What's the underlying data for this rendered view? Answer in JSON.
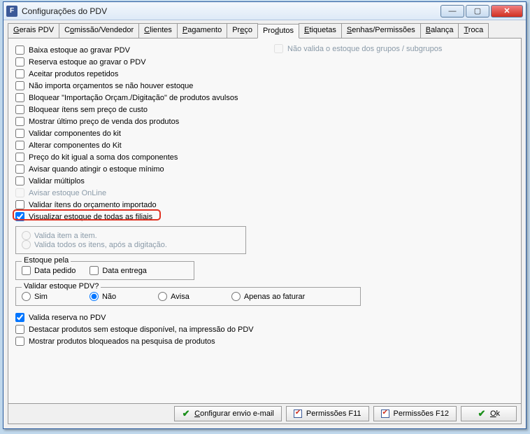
{
  "window": {
    "title": "Configurações do PDV",
    "icon_letter": "F"
  },
  "tabs": [
    {
      "label": "Gerais PDV",
      "accel_index": 0
    },
    {
      "label": "Comissão/Vendedor",
      "accel_index": 1
    },
    {
      "label": "Clientes",
      "accel_index": 0
    },
    {
      "label": "Pagamento",
      "accel_index": 0
    },
    {
      "label": "Preço",
      "accel_index": 2
    },
    {
      "label": "Produtos",
      "accel_index": 3
    },
    {
      "label": "Etiquetas",
      "accel_index": 0
    },
    {
      "label": "Senhas/Permissões",
      "accel_index": 0
    },
    {
      "label": "Balança",
      "accel_index": 0
    },
    {
      "label": "Troca",
      "accel_index": 0
    }
  ],
  "active_tab": 5,
  "checkboxes_left": [
    {
      "label": "Baixa estoque ao gravar PDV",
      "checked": false,
      "disabled": false
    },
    {
      "label": "Reserva estoque ao gravar o PDV",
      "checked": false,
      "disabled": false
    },
    {
      "label": "Aceitar produtos repetidos",
      "checked": false,
      "disabled": false
    },
    {
      "label": "Não importa orçamentos se não houver estoque",
      "checked": false,
      "disabled": false
    },
    {
      "label": "Bloquear \"Importação Orçam./Digitação\" de produtos avulsos",
      "checked": false,
      "disabled": false
    },
    {
      "label": "Bloquear ítens sem preço de custo",
      "checked": false,
      "disabled": false
    },
    {
      "label": "Mostrar último preço de venda dos produtos",
      "checked": false,
      "disabled": false
    },
    {
      "label": "Validar componentes do kit",
      "checked": false,
      "disabled": false
    },
    {
      "label": "Alterar componentes do Kit",
      "checked": false,
      "disabled": false
    },
    {
      "label": "Preço do kit igual a soma dos componentes",
      "checked": false,
      "disabled": false
    },
    {
      "label": "Avisar quando atingir o estoque mínimo",
      "checked": false,
      "disabled": false
    },
    {
      "label": "Validar múltiplos",
      "checked": false,
      "disabled": false
    },
    {
      "label": "Avisar estoque OnLine",
      "checked": false,
      "disabled": true
    },
    {
      "label": "Validar ítens do orçamento importado",
      "checked": false,
      "disabled": false
    },
    {
      "label": "Visualizar estoque de todas as filiais",
      "checked": true,
      "disabled": false,
      "highlight": true
    }
  ],
  "right_checkbox": {
    "label": "Não valida o estoque dos grupos / subgrupos",
    "checked": false,
    "disabled": true
  },
  "valida_group": {
    "options": [
      "Valida item a item.",
      "Valida todos os itens, após a digitação."
    ],
    "disabled": true
  },
  "estoque_pela": {
    "legend": "Estoque pela",
    "options": [
      {
        "label": "Data pedido",
        "checked": false
      },
      {
        "label": "Data entrega",
        "checked": false
      }
    ]
  },
  "validar_estoque": {
    "legend": "Validar estoque PDV?",
    "options": [
      "Sim",
      "Não",
      "Avisa",
      "Apenas ao faturar"
    ],
    "selected": 1
  },
  "checkboxes_bottom": [
    {
      "label": "Valida reserva no PDV",
      "checked": true
    },
    {
      "label": "Destacar produtos sem estoque disponível, na impressão do PDV",
      "checked": false
    },
    {
      "label": "Mostrar produtos bloqueados na pesquisa de produtos",
      "checked": false
    }
  ],
  "buttons": {
    "configurar": "Configurar envio e-mail",
    "perm_f11": "Permissões F11",
    "perm_f12": "Permissões F12",
    "ok": "Ok"
  }
}
